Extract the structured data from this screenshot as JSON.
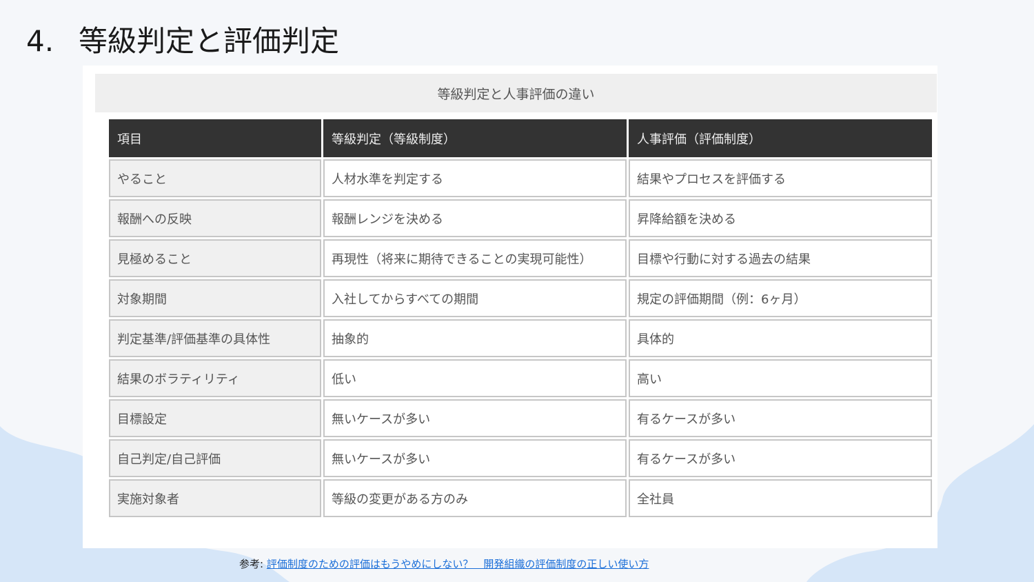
{
  "title": {
    "number": "4.",
    "text": "等級判定と評価判定"
  },
  "table": {
    "caption": "等級判定と人事評価の違い",
    "headers": [
      "項目",
      "等級判定（等級制度）",
      "人事評価（評価制度）"
    ],
    "rows": [
      [
        "やること",
        "人材水準を判定する",
        "結果やプロセスを評価する"
      ],
      [
        "報酬への反映",
        "報酬レンジを決める",
        "昇降給額を決める"
      ],
      [
        "見極めること",
        "再現性（将来に期待できることの実現可能性）",
        "目標や行動に対する過去の結果"
      ],
      [
        "対象期間",
        "入社してからすべての期間",
        "規定の評価期間（例：6ヶ月）"
      ],
      [
        "判定基準/評価基準の具体性",
        "抽象的",
        "具体的"
      ],
      [
        "結果のボラティリティ",
        "低い",
        "高い"
      ],
      [
        "目標設定",
        "無いケースが多い",
        "有るケースが多い"
      ],
      [
        "自己判定/自己評価",
        "無いケースが多い",
        "有るケースが多い"
      ],
      [
        "実施対象者",
        "等級の変更がある方のみ",
        "全社員"
      ]
    ]
  },
  "reference": {
    "prefix": "参考:",
    "link_text": "評価制度のための評価はもうやめにしない？　開発組織の評価制度の正しい使い方"
  },
  "colors": {
    "background": "#f5f7fa",
    "wave": "#d6e6f8",
    "header_bg": "#333333",
    "caption_bg": "#efefef",
    "rowhead_bg": "#f0f0f0",
    "link": "#1a6ed8"
  }
}
